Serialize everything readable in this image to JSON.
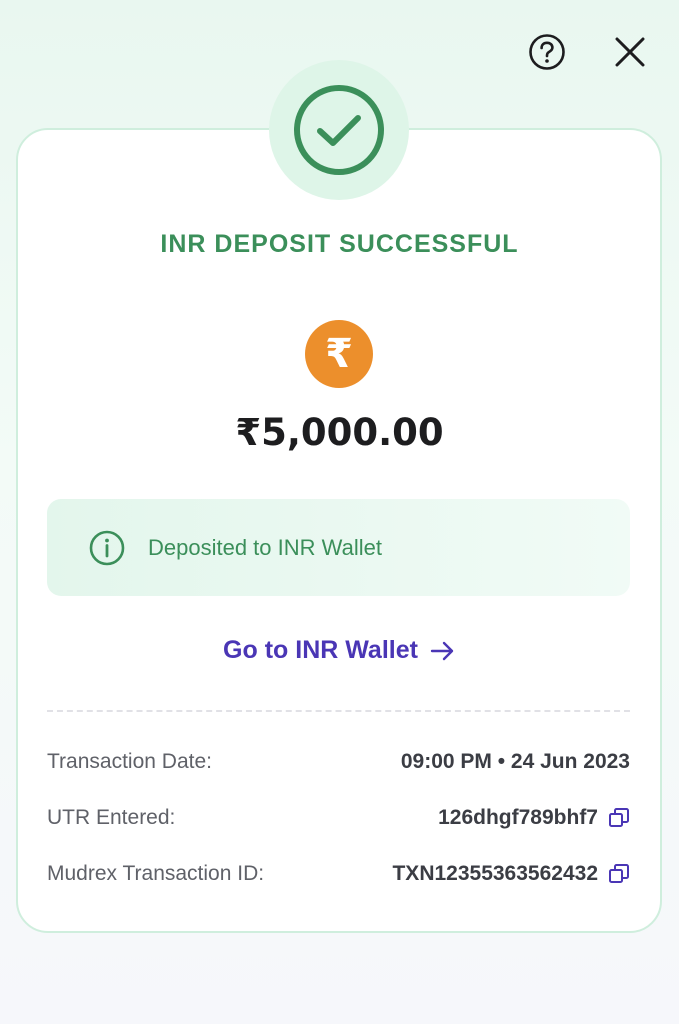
{
  "header": {
    "help_icon": "help-circle-icon",
    "close_icon": "close-icon"
  },
  "status": {
    "icon": "check-circle-icon",
    "title": "INR DEPOSIT SUCCESSFUL",
    "color": "#3b8f5a"
  },
  "currency": {
    "symbol": "₹",
    "coin_color": "#ec8f2c",
    "amount": "₹5,000.00"
  },
  "info": {
    "icon": "info-icon",
    "text": "Deposited to INR Wallet"
  },
  "link": {
    "label": "Go to INR Wallet",
    "icon": "arrow-right-icon",
    "color": "#4a36b5"
  },
  "details": {
    "transaction_date_label": "Transaction Date:",
    "transaction_date_value": "09:00 PM • 24 Jun 2023",
    "utr_label": "UTR Entered:",
    "utr_value": "126dhgf789bhf7",
    "txn_id_label": "Mudrex Transaction ID:",
    "txn_id_value": "TXN12355363562432"
  }
}
